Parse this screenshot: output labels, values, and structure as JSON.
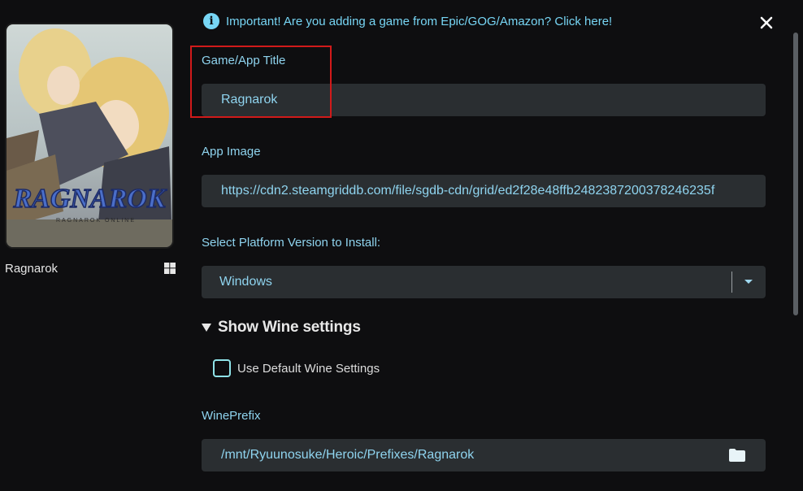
{
  "game": {
    "name": "Ragnarok",
    "platform_icon": "windows-icon",
    "cover_logo_text": "RAGNAROK",
    "cover_sub_text": "RAGNAROK ONLINE"
  },
  "banner": {
    "icon": "info-icon",
    "text": "Important! Are you adding a game from Epic/GOG/Amazon? Click here!"
  },
  "form": {
    "title_label": "Game/App Title",
    "title_value": "Ragnarok",
    "image_label": "App Image",
    "image_value": "https://cdn2.steamgriddb.com/file/sgdb-cdn/grid/ed2f28e48ffb2482387200378246235f",
    "platform_label": "Select Platform Version to Install:",
    "platform_value": "Windows",
    "wine_section_label": "Show Wine settings",
    "default_wine_label": "Use Default Wine Settings",
    "default_wine_checked": false,
    "wineprefix_label": "WinePrefix",
    "wineprefix_value": "/mnt/Ryuunosuke/Heroic/Prefixes/Ragnarok"
  },
  "colors": {
    "accent": "#8fd4ef",
    "field_bg": "#2a2e31",
    "highlight": "#d11a1a",
    "background": "#0e0e10"
  }
}
